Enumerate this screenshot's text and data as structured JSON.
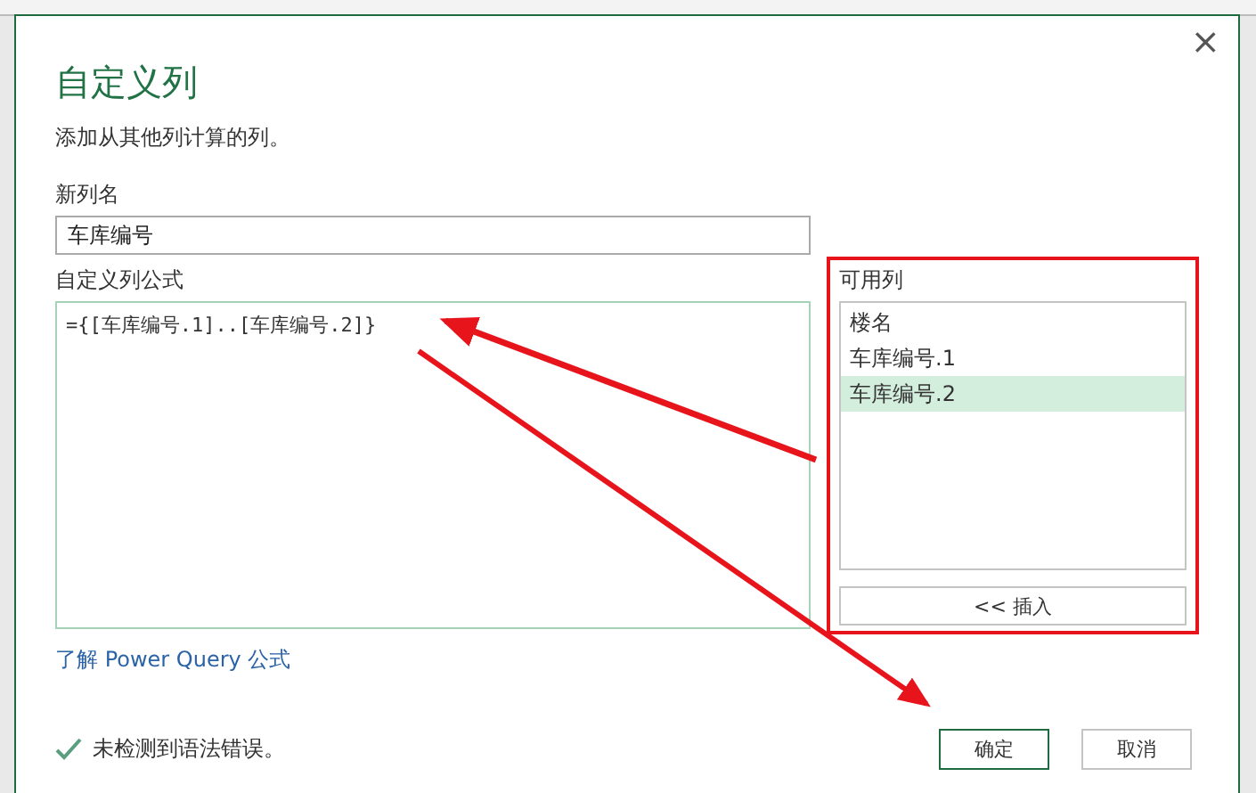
{
  "dialog": {
    "title": "自定义列",
    "subtitle": "添加从其他列计算的列。",
    "close": "×"
  },
  "name_field": {
    "label": "新列名",
    "value": "车库编号"
  },
  "formula_field": {
    "label": "自定义列公式",
    "value": "={[车库编号.1]..[车库编号.2]}"
  },
  "available_columns": {
    "label": "可用列",
    "items": [
      {
        "label": "楼名",
        "selected": false
      },
      {
        "label": "车库编号.1",
        "selected": false
      },
      {
        "label": "车库编号.2",
        "selected": true
      }
    ],
    "insert_button": "<< 插入"
  },
  "link": "了解 Power Query 公式",
  "status": {
    "ok": true,
    "text": "未检测到语法错误。"
  },
  "buttons": [
    {
      "label": "确定",
      "primary": true
    },
    {
      "label": "取消",
      "primary": false
    }
  ]
}
